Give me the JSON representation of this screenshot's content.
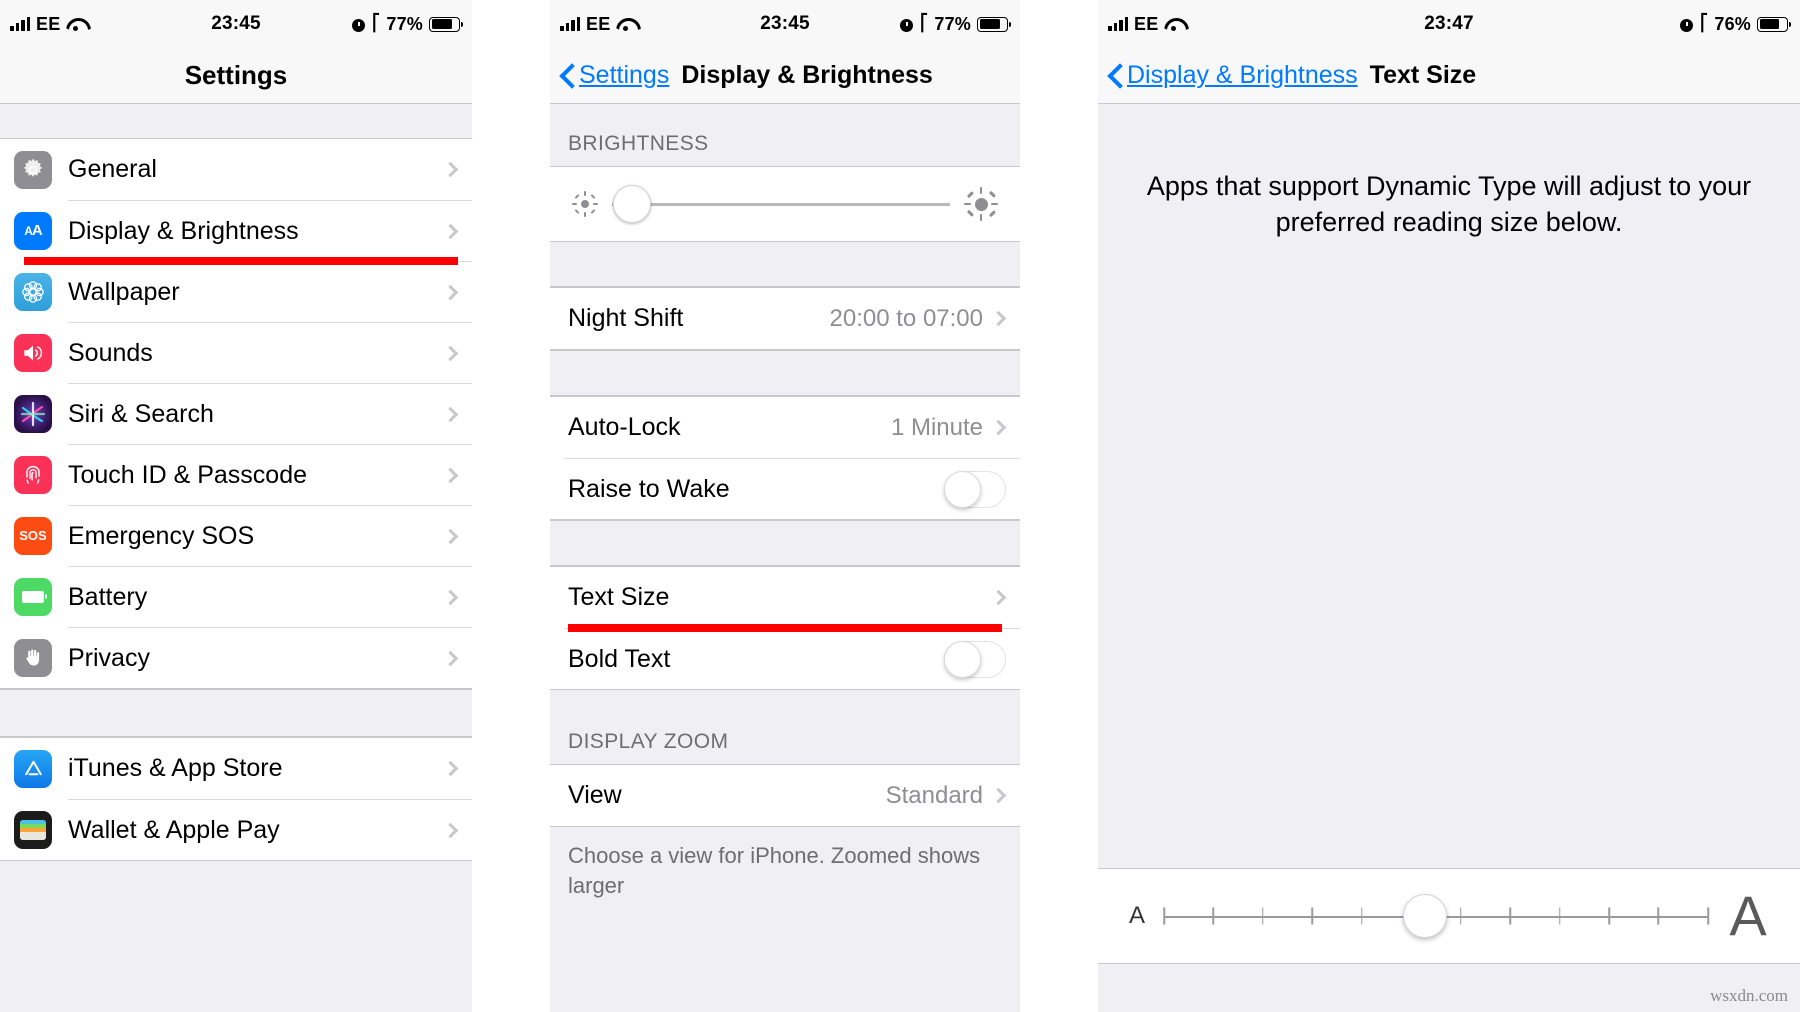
{
  "statusbar": {
    "carrier": "EE",
    "time_1": "23:45",
    "time_2": "23:45",
    "time_3": "23:47",
    "battery_1": "77%",
    "battery_2": "77%",
    "battery_3": "76%"
  },
  "panel1": {
    "title": "Settings",
    "group_a": [
      {
        "label": "General",
        "icon": "gear-icon"
      },
      {
        "label": "Display & Brightness",
        "icon": "text-size-aa-icon",
        "highlighted": true
      },
      {
        "label": "Wallpaper",
        "icon": "flower-icon"
      },
      {
        "label": "Sounds",
        "icon": "speaker-icon"
      },
      {
        "label": "Siri & Search",
        "icon": "siri-icon"
      },
      {
        "label": "Touch ID & Passcode",
        "icon": "fingerprint-icon"
      },
      {
        "label": "Emergency SOS",
        "icon": "sos-icon"
      },
      {
        "label": "Battery",
        "icon": "battery-icon"
      },
      {
        "label": "Privacy",
        "icon": "hand-icon"
      }
    ],
    "group_b": [
      {
        "label": "iTunes & App Store",
        "icon": "app-store-icon"
      },
      {
        "label": "Wallet & Apple Pay",
        "icon": "wallet-icon"
      }
    ]
  },
  "panel2": {
    "back_label": "Settings",
    "title": "Display & Brightness",
    "brightness_header": "BRIGHTNESS",
    "brightness_value_pct": 6,
    "rows": [
      {
        "label": "Night Shift",
        "value": "20:00 to 07:00",
        "type": "disclosure"
      },
      {
        "label": "Auto-Lock",
        "value": "1 Minute",
        "type": "disclosure"
      },
      {
        "label": "Raise to Wake",
        "value": "",
        "type": "toggle",
        "on": false
      },
      {
        "label": "Text Size",
        "value": "",
        "type": "disclosure",
        "highlighted": true
      },
      {
        "label": "Bold Text",
        "value": "",
        "type": "toggle",
        "on": false
      }
    ],
    "zoom_header": "DISPLAY ZOOM",
    "view_label": "View",
    "view_value": "Standard",
    "footer_text": "Choose a view for iPhone. Zoomed shows larger"
  },
  "panel3": {
    "back_label": "Display & Brightness",
    "title": "Text Size",
    "description": "Apps that support Dynamic Type will adjust to your preferred reading size below.",
    "slider": {
      "small_a": "A",
      "large_a": "A",
      "ticks": 12,
      "value_index": 5
    }
  },
  "watermark": "wsxdn.com",
  "colors": {
    "accent_blue": "#007aff",
    "highlight_red": "#ff0000",
    "group_bg": "#efeff4",
    "separator": "#c8c7cc",
    "value_gray": "#8e8e93"
  }
}
